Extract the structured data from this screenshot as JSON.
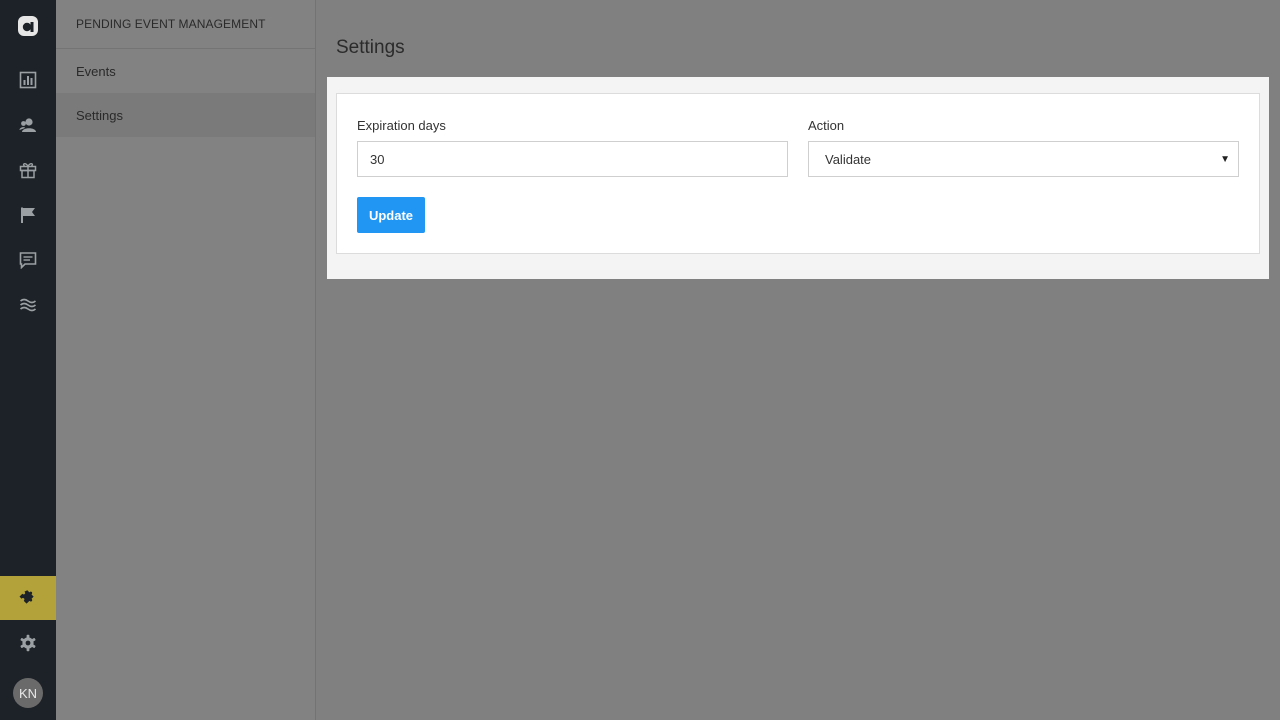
{
  "rail": {
    "items": [
      {
        "icon": "dashboard-icon"
      },
      {
        "icon": "users-icon"
      },
      {
        "icon": "gift-icon"
      },
      {
        "icon": "flag-icon"
      },
      {
        "icon": "comment-icon"
      },
      {
        "icon": "waves-icon"
      },
      {
        "icon": "puzzle-icon",
        "active": true
      },
      {
        "icon": "gear-icon"
      }
    ],
    "avatar_initials": "KN",
    "active_color": "#b3a23a"
  },
  "sidebar": {
    "header": "PENDING EVENT MANAGEMENT",
    "items": [
      {
        "label": "Events"
      },
      {
        "label": "Settings",
        "active": true
      }
    ]
  },
  "main": {
    "title": "Settings",
    "form": {
      "expiration_label": "Expiration days",
      "expiration_value": "30",
      "action_label": "Action",
      "action_value": "Validate",
      "update_label": "Update"
    }
  },
  "colors": {
    "primary_button": "#2196f3",
    "rail_bg": "#1c2227"
  }
}
